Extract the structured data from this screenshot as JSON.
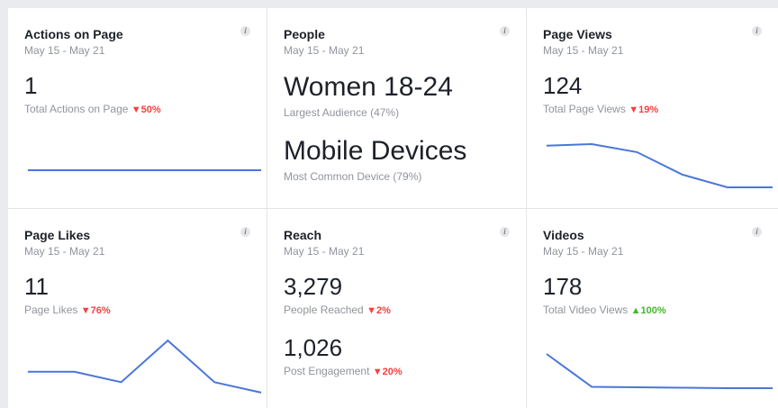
{
  "cards": [
    {
      "title": "Actions on Page",
      "date": "May 15 - May 21",
      "value": "1",
      "sub": "Total Actions on Page",
      "delta": "50%",
      "dir": "down",
      "spark": [
        1,
        1,
        1,
        1,
        1,
        1
      ]
    },
    {
      "title": "People",
      "date": "May 15 - May 21",
      "value": "Women 18-24",
      "sub": "Largest Audience (47%)",
      "value2": "Mobile Devices",
      "sub2": "Most Common Device (79%)"
    },
    {
      "title": "Page Views",
      "date": "May 15 - May 21",
      "value": "124",
      "sub": "Total Page Views",
      "delta": "19%",
      "dir": "down",
      "spark": [
        31,
        32,
        27,
        13,
        5,
        5
      ]
    },
    {
      "title": "Page Likes",
      "date": "May 15 - May 21",
      "value": "11",
      "sub": "Page Likes",
      "delta": "76%",
      "dir": "down",
      "spark": [
        2,
        2,
        1,
        5,
        1,
        0
      ]
    },
    {
      "title": "Reach",
      "date": "May 15 - May 21",
      "value": "3,279",
      "sub": "People Reached",
      "delta": "2%",
      "dir": "down",
      "value2": "1,026",
      "sub2": "Post Engagement",
      "delta2": "20%",
      "dir2": "down"
    },
    {
      "title": "Videos",
      "date": "May 15 - May 21",
      "value": "178",
      "sub": "Total Video Views",
      "delta": "100%",
      "dir": "up",
      "spark": [
        80,
        5,
        4,
        3,
        2,
        2
      ]
    }
  ],
  "colors": {
    "line": "#4a76d9",
    "down": "#fa3e3e",
    "up": "#42b72a"
  },
  "icons": {
    "info": "info-icon",
    "down": "triangle-down-icon",
    "up": "triangle-up-icon"
  }
}
